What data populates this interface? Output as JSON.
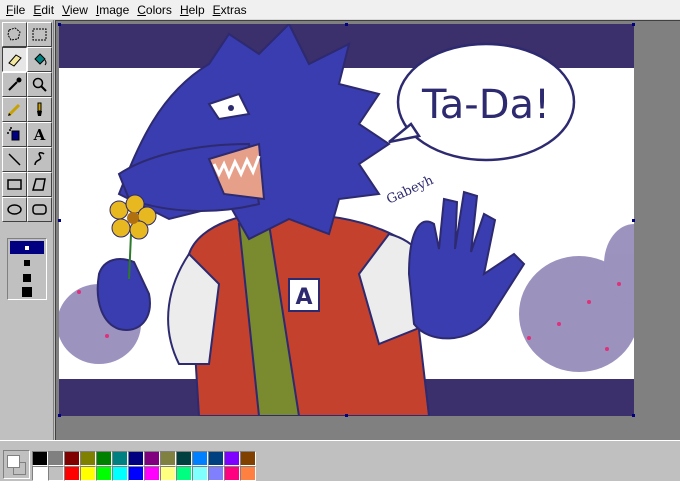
{
  "menu": {
    "items": [
      {
        "key": "F",
        "rest": "ile"
      },
      {
        "key": "E",
        "rest": "dit"
      },
      {
        "key": "V",
        "rest": "iew"
      },
      {
        "key": "I",
        "rest": "mage"
      },
      {
        "key": "C",
        "rest": "olors"
      },
      {
        "key": "H",
        "rest": "elp"
      },
      {
        "key": "E",
        "rest": "xtras"
      }
    ]
  },
  "tools": [
    {
      "name": "free-select-icon"
    },
    {
      "name": "rect-select-icon"
    },
    {
      "name": "eraser-icon",
      "active": true
    },
    {
      "name": "fill-bucket-icon"
    },
    {
      "name": "color-picker-icon"
    },
    {
      "name": "magnifier-icon"
    },
    {
      "name": "pencil-icon"
    },
    {
      "name": "brush-icon"
    },
    {
      "name": "airbrush-icon"
    },
    {
      "name": "text-icon",
      "glyph": "A"
    },
    {
      "name": "line-icon"
    },
    {
      "name": "curve-icon"
    },
    {
      "name": "rectangle-icon"
    },
    {
      "name": "polygon-icon"
    },
    {
      "name": "ellipse-icon"
    },
    {
      "name": "rounded-rect-icon"
    }
  ],
  "artwork": {
    "speech_text": "Ta-Da!",
    "signature": "Gabeyh",
    "letter_on_jacket": "A"
  },
  "colors": {
    "foreground": "#ffffff",
    "background": "#c0c0c0",
    "palette": [
      "#000000",
      "#808080",
      "#800000",
      "#808000",
      "#008000",
      "#008080",
      "#000080",
      "#800080",
      "#808040",
      "#004040",
      "#0080ff",
      "#004080",
      "#8000ff",
      "#804000",
      "#ffffff",
      "#c0c0c0",
      "#ff0000",
      "#ffff00",
      "#00ff00",
      "#00ffff",
      "#0000ff",
      "#ff00ff",
      "#ffff80",
      "#00ff80",
      "#80ffff",
      "#8080ff",
      "#ff0080",
      "#ff8040"
    ]
  }
}
